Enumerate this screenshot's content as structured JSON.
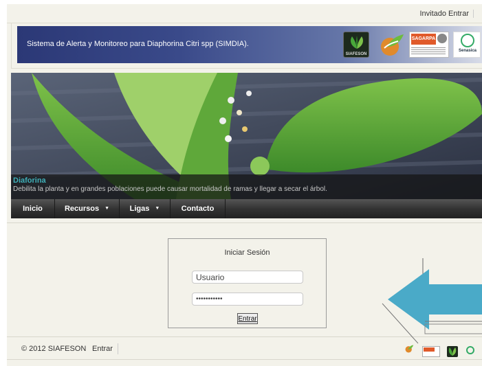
{
  "topbar": {
    "user_text": "Invitado Entrar"
  },
  "header": {
    "title": "Sistema de Alerta y Monitoreo para Diaphorina Citri spp (SIMDIA).",
    "logo1_text": "SIAFESON",
    "logo3_text": "SAGARPA",
    "logo4_text": "Senasica"
  },
  "hero": {
    "title": "Diaforina",
    "text": "Debilita la planta y en grandes poblaciones puede causar mortalidad de ramas y llegar a secar el árbol."
  },
  "nav": {
    "items": [
      {
        "label": "Inicio",
        "dropdown": false
      },
      {
        "label": "Recursos",
        "dropdown": true
      },
      {
        "label": "Ligas",
        "dropdown": true
      },
      {
        "label": "Contacto",
        "dropdown": false
      }
    ]
  },
  "login": {
    "title": "Iniciar Sesión",
    "username_value": "Usuario",
    "password_value": "•••••••••••",
    "submit_label": "Entrar"
  },
  "footer": {
    "copyright": "© 2012 SIAFESON",
    "link": "Entrar"
  },
  "colors": {
    "banner": "#2b3876",
    "caption_title": "#3fb0b8",
    "arrow": "#4aaac8",
    "nav": "#333333"
  },
  "icons": [
    "siafeson-logo-icon",
    "fruit-logo-icon",
    "sagarpa-logo-icon",
    "senasica-logo-icon",
    "left-arrow-icon"
  ]
}
